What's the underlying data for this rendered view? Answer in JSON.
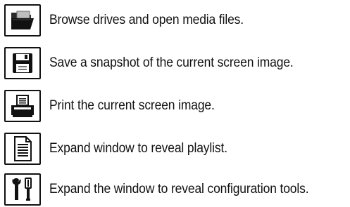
{
  "items": [
    {
      "icon": "folder-open-icon",
      "label": "Browse drives and open media files."
    },
    {
      "icon": "floppy-disk-icon",
      "label": "Save a snapshot of the current screen image."
    },
    {
      "icon": "printer-icon",
      "label": "Print the current screen image."
    },
    {
      "icon": "document-list-icon",
      "label": "Expand window to reveal playlist."
    },
    {
      "icon": "tools-icon",
      "label": "Expand the window to reveal configuration tools."
    }
  ],
  "colors": {
    "icon_stroke": "#111111",
    "text": "#111111",
    "background": "#ffffff"
  }
}
